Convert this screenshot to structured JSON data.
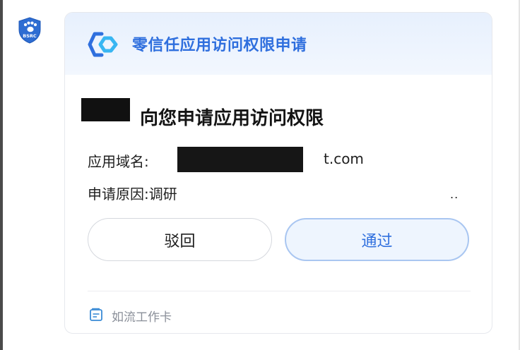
{
  "sender": {
    "avatar_icon": "bsrc-badge-icon",
    "avatar_text": "BSRC"
  },
  "card": {
    "header": {
      "logo_icon": "hexagon-link-logo-icon",
      "title": "零信任应用访问权限申请"
    },
    "request_title": "向您申请应用访问权限",
    "fields": {
      "domain_label": "应用域名:",
      "domain_suffix": "t.com",
      "reason_label": "申请原因:",
      "reason_value": "调研",
      "reason_ellipsis": ".."
    },
    "actions": {
      "reject_label": "驳回",
      "approve_label": "通过"
    },
    "footer": {
      "icon": "work-card-icon",
      "label": "如流工作卡"
    }
  },
  "colors": {
    "accent": "#2f6fde",
    "header_bg": "#e7f0fd",
    "approve_border": "#a9c6f1",
    "muted_text": "#8a8f99"
  }
}
